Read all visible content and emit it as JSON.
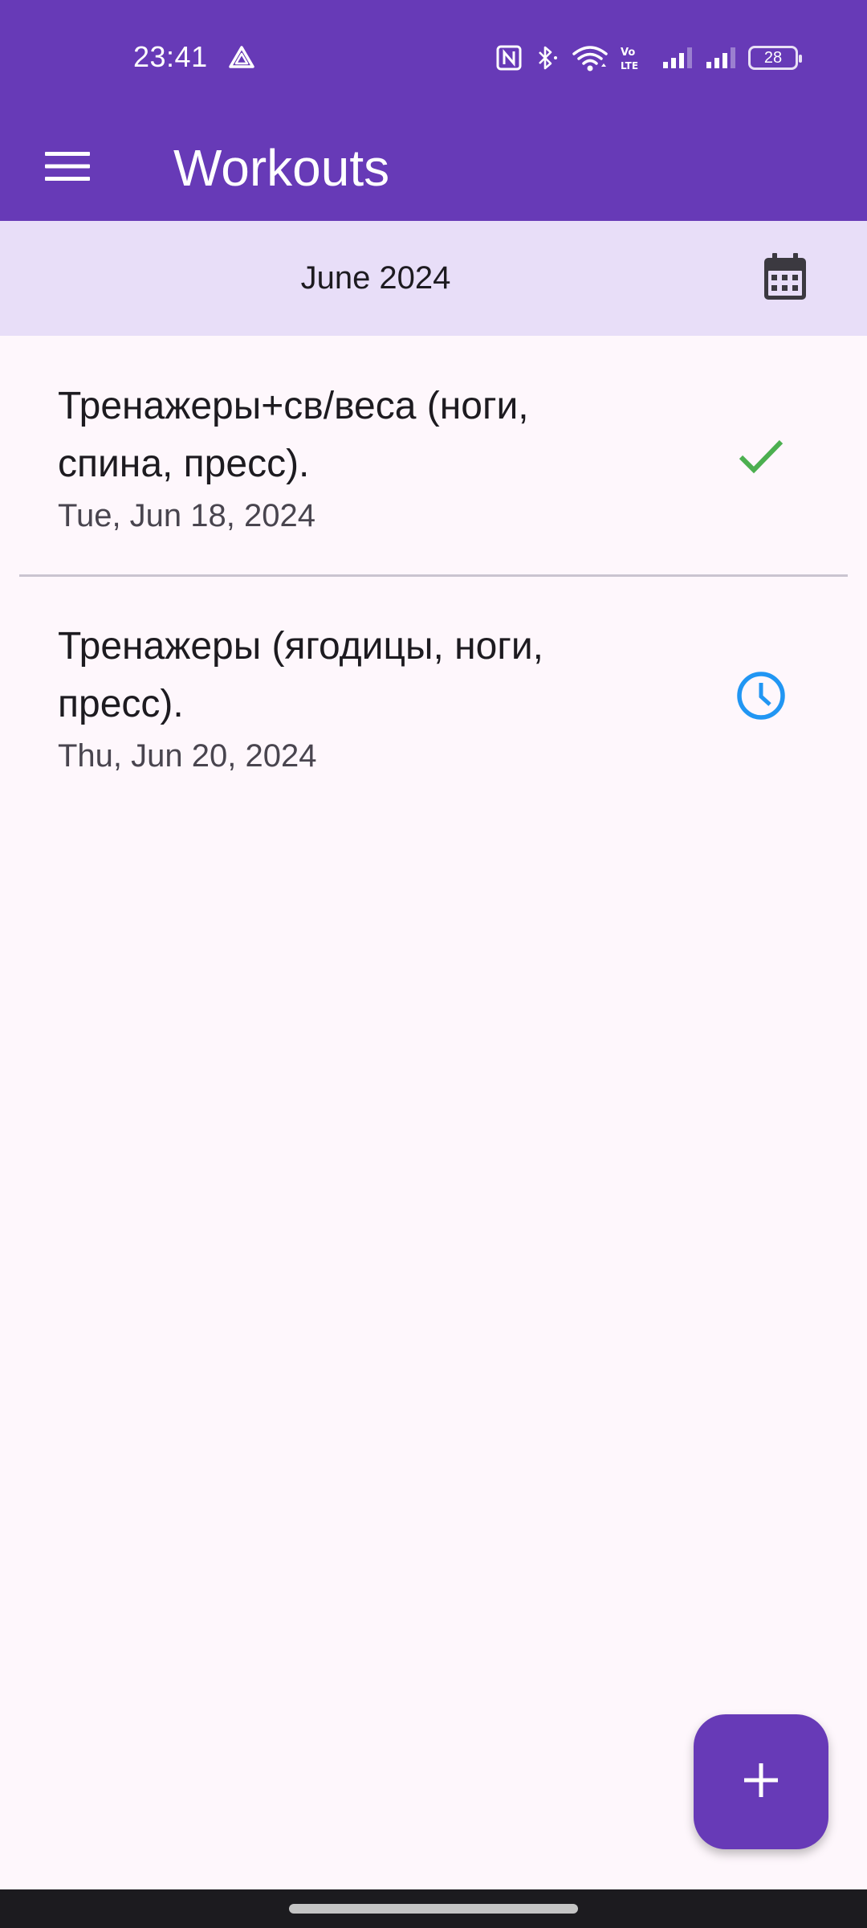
{
  "status_bar": {
    "time": "23:41",
    "battery": "28",
    "icons": [
      "navigation-icon",
      "nfc-icon",
      "bluetooth-icon",
      "wifi-icon",
      "volte-icon",
      "signal-icon",
      "signal-icon"
    ]
  },
  "app_bar": {
    "title": "Workouts",
    "menu_icon": "menu-icon"
  },
  "month_bar": {
    "label": "June 2024",
    "calendar_icon": "calendar-icon"
  },
  "workouts": [
    {
      "title_line1": "Тренажеры+св/веса (ноги,",
      "title_line2": "спина, пресс).",
      "date": "Tue, Jun 18, 2024",
      "status_icon": "check-icon",
      "status_color": "#4caf50"
    },
    {
      "title_line1": "Тренажеры (ягодицы, ноги,",
      "title_line2": "пресс).",
      "date": "Thu, Jun 20, 2024",
      "status_icon": "clock-icon",
      "status_color": "#2196f3"
    }
  ],
  "fab": {
    "icon": "add-icon"
  },
  "colors": {
    "primary": "#673ab7",
    "month_bar_bg": "#e8def8",
    "background": "#fef7fc"
  }
}
